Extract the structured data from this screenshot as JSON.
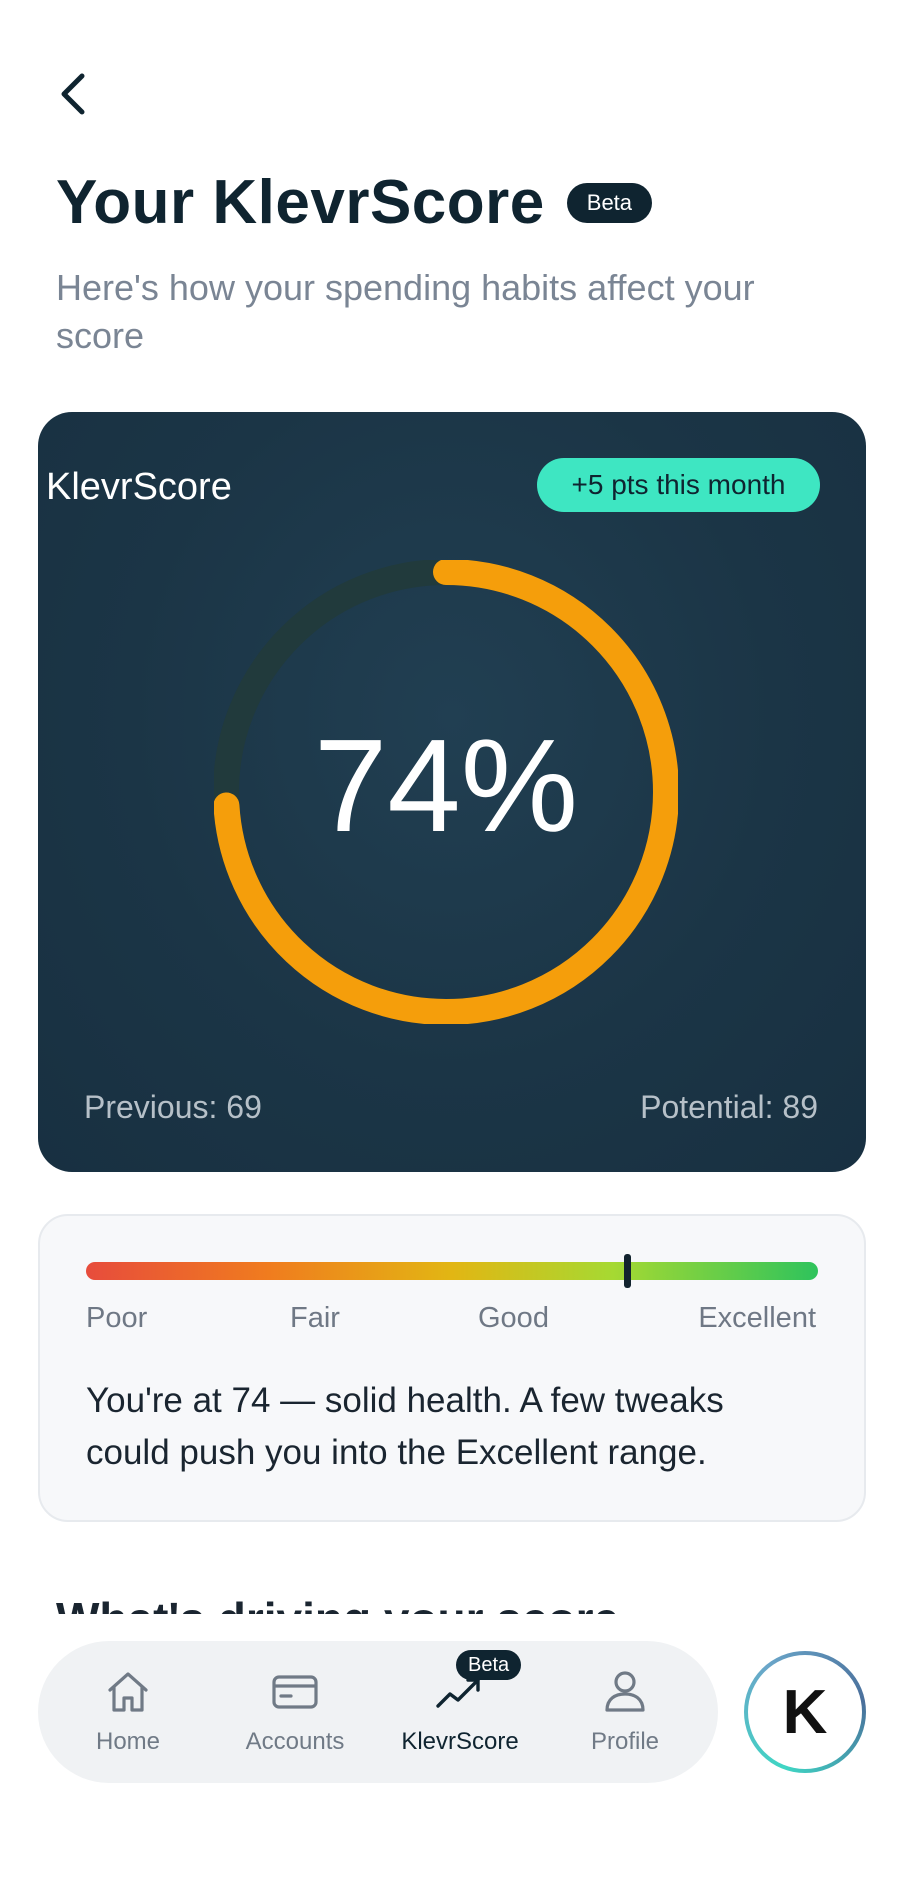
{
  "header": {
    "title": "Your KlevrScore",
    "badge": "Beta",
    "subtitle": "Here's how your spending habits affect your score"
  },
  "score_card": {
    "label": "KlevrScore",
    "trend": "+5 pts this month",
    "score_text": "74%",
    "score_fraction": 0.74,
    "previous": "Previous: 69",
    "potential": "Potential: 89",
    "colors": {
      "card_bg": "#1b3546",
      "ring_fill": "#f59e0b",
      "ring_track": "#213a3c",
      "trend_pill": "#3ee6c2"
    }
  },
  "range": {
    "labels": [
      "Poor",
      "Fair",
      "Good",
      "Excellent"
    ],
    "marker_position_fraction": 0.74,
    "description": "You're at 74 — solid health. A few tweaks could push you into the Excellent range."
  },
  "section": {
    "heading": "What's driving your score"
  },
  "nav": {
    "items": [
      {
        "label": "Home",
        "icon": "home-icon"
      },
      {
        "label": "Accounts",
        "icon": "card-icon"
      },
      {
        "label": "KlevrScore",
        "icon": "trend-up-icon",
        "active": true,
        "badge": "Beta"
      },
      {
        "label": "Profile",
        "icon": "person-icon"
      }
    ],
    "fab_label": "K"
  }
}
